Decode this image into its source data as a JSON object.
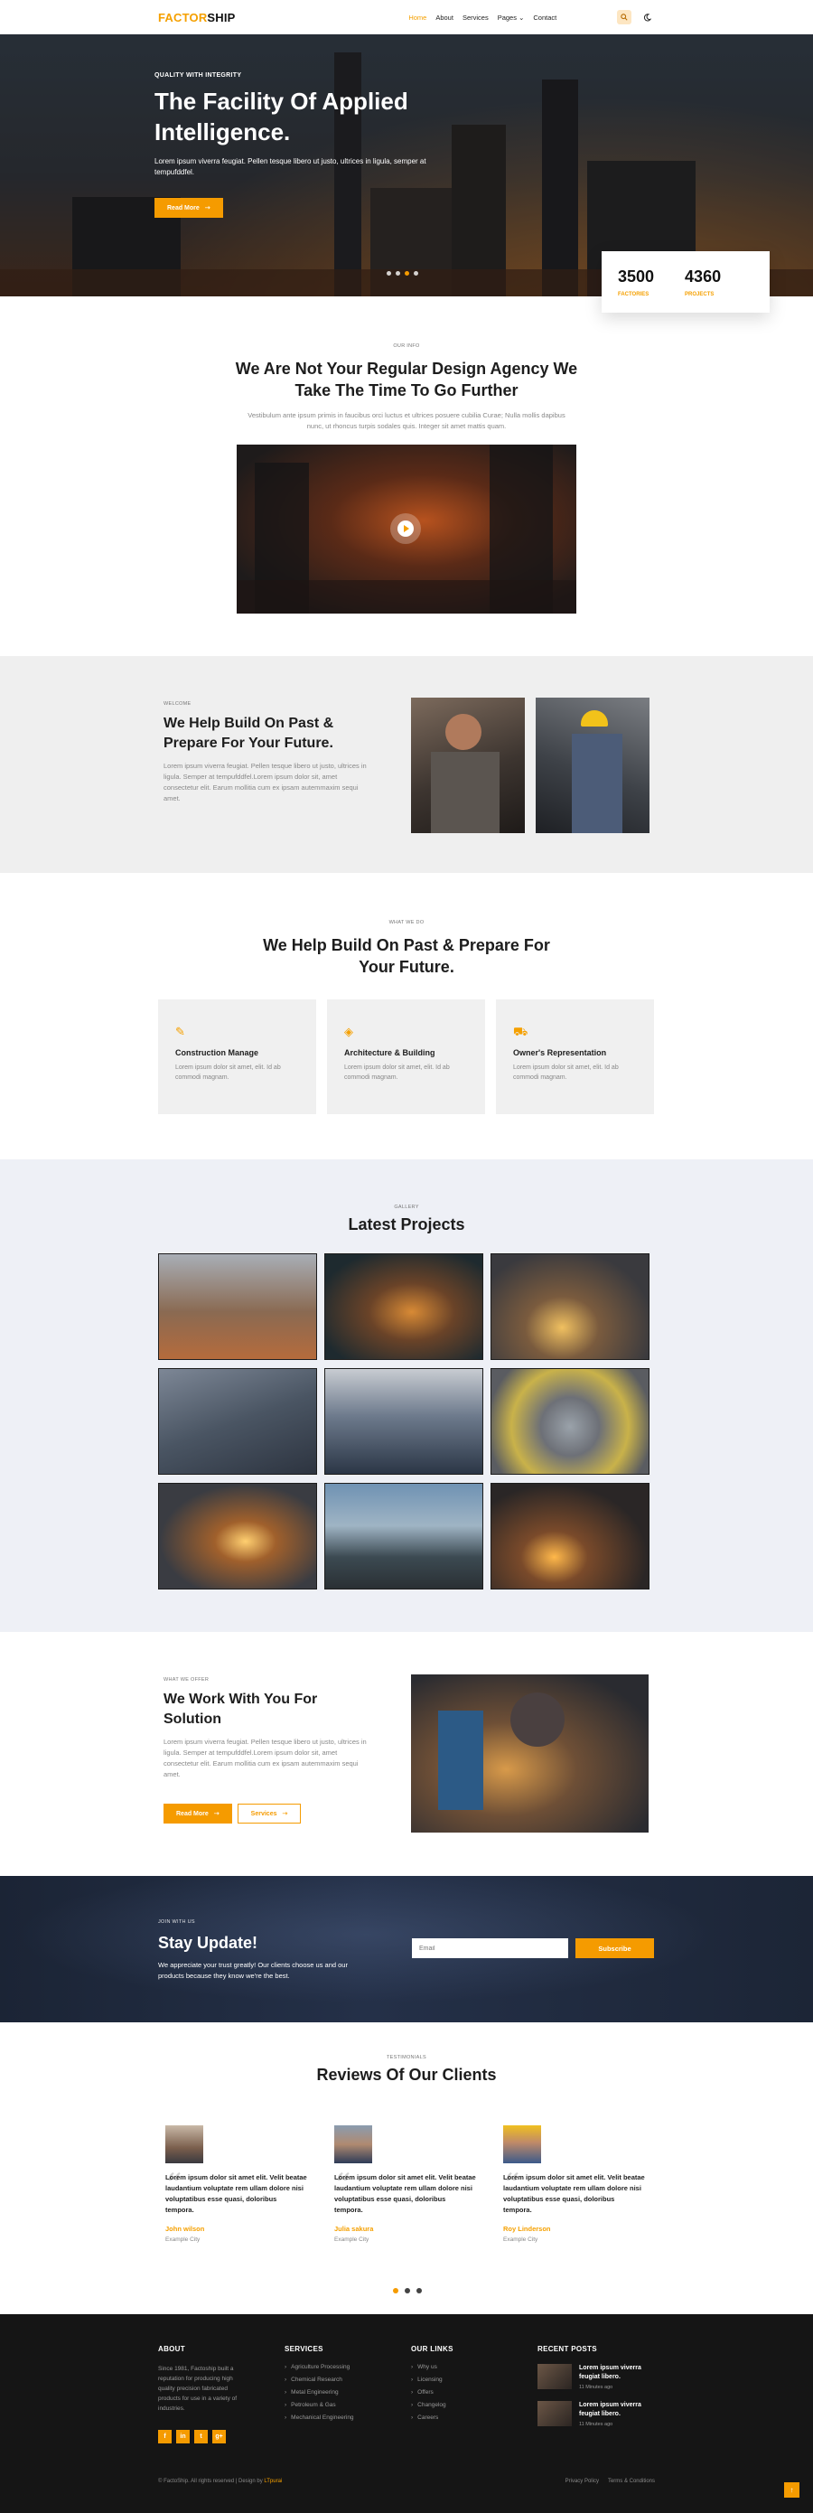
{
  "brand": {
    "part1": "FACTOR",
    "part2": "SHIP",
    "accent": "#f5a000"
  },
  "nav": {
    "items": [
      "Home",
      "About",
      "Services",
      "Pages",
      "Contact"
    ],
    "pages_caret": "⌄"
  },
  "hero": {
    "kicker": "QUALITY WITH INTEGRITY",
    "title_line1": "The Facility Of Applied",
    "title_line2": "Intelligence.",
    "description": "Lorem ipsum viverra feugiat. Pellen tesque libero ut justo, ultrices in ligula, semper at tempufddfel.",
    "button": "Read More"
  },
  "stats": [
    {
      "number": "3500",
      "label": "FACTORIES"
    },
    {
      "number": "4360",
      "label": "PROJECTS"
    }
  ],
  "about": {
    "kicker": "OUR INFO",
    "title_line1": "We Are Not Your Regular Design Agency We",
    "title_line2": "Take The Time To Go Further",
    "description": "Vestibulum ante ipsum primis in faucibus orci luctus et ultrices posuere cubilia Curae; Nulla mollis dapibus nunc, ut rhoncus turpis sodales quis. Integer sit amet mattis quam."
  },
  "welcome": {
    "kicker": "WELCOME",
    "title_line1": "We Help Build On Past &",
    "title_line2": "Prepare For Your Future.",
    "description": "Lorem ipsum viverra feugiat. Pellen tesque libero ut justo, ultrices in ligula. Semper at tempufddfel.Lorem ipsum dolor sit, amet consectetur elit. Earum mollitia cum ex ipsam autemmaxim sequi amet."
  },
  "services": {
    "kicker": "WHAT WE DO",
    "title_line1": "We Help Build On Past & Prepare For",
    "title_line2": "Your Future.",
    "cards": [
      {
        "title": "Construction Manage",
        "desc": "Lorem ipsum dolor sit amet, elit. Id ab commodi magnam."
      },
      {
        "title": "Architecture & Building",
        "desc": "Lorem ipsum dolor sit amet, elit. Id ab commodi magnam."
      },
      {
        "title": "Owner's Representation",
        "desc": "Lorem ipsum dolor sit amet, elit. Id ab commodi magnam."
      }
    ]
  },
  "gallery": {
    "kicker": "GALLERY",
    "title": "Latest Projects"
  },
  "offer": {
    "kicker": "WHAT WE OFFER",
    "title_line1": "We Work With You For",
    "title_line2": "Solution",
    "description": "Lorem ipsum viverra feugiat. Pellen tesque libero ut justo, ultrices in ligula. Semper at tempufddfel.Lorem ipsum dolor sit, amet consectetur elit. Earum mollitia cum ex ipsam autemmaxim sequi amet.",
    "button_primary": "Read More",
    "button_secondary": "Services"
  },
  "newsletter": {
    "kicker": "JOIN WITH US",
    "title": "Stay Update!",
    "description": "We appreciate your trust greatly! Our clients choose us and our products because they know we're the best.",
    "placeholder": "Email",
    "button": "Subscribe"
  },
  "reviews": {
    "kicker": "TESTIMONIALS",
    "title": "Reviews Of Our Clients",
    "items": [
      {
        "quote": "Lorem ipsum dolor sit amet elit. Velit beatae laudantium voluptate rem ullam dolore nisi voluptatibus esse quasi, doloribus tempora.",
        "name": "John wilson",
        "city": "Example City"
      },
      {
        "quote": "Lorem ipsum dolor sit amet elit. Velit beatae laudantium voluptate rem ullam dolore nisi voluptatibus esse quasi, doloribus tempora.",
        "name": "Julia sakura",
        "city": "Example City"
      },
      {
        "quote": "Lorem ipsum dolor sit amet elit. Velit beatae laudantium voluptate rem ullam dolore nisi voluptatibus esse quasi, doloribus tempora.",
        "name": "Roy Linderson",
        "city": "Example City"
      }
    ]
  },
  "footer": {
    "about_title": "ABOUT",
    "about_text": "Since 1981, Factoship built a reputation for producing high quality precision fabricated products for use in a variety of industries.",
    "services_title": "SERVICES",
    "services": [
      "Agriculture Processing",
      "Chemical Research",
      "Metal Engineering",
      "Petroleum & Gas",
      "Mechanical Engineering"
    ],
    "links_title": "OUR LINKS",
    "links": [
      "Why us",
      "Licensing",
      "Offers",
      "Changelog",
      "Careers"
    ],
    "posts_title": "RECENT POSTS",
    "posts": [
      {
        "title": "Lorem ipsum viverra feugiat libero.",
        "date": "11 Minutes ago"
      },
      {
        "title": "Lorem ipsum viverra feugiat libero.",
        "date": "11 Minutes ago"
      }
    ],
    "socials": [
      "f",
      "in",
      "t",
      "g+"
    ],
    "copyright_prefix": "© FactoShip. All rights reserved | Design by",
    "copyright_author": "LTpurai",
    "bottom_links": [
      "Privacy Policy",
      "Terms & Conditions"
    ],
    "to_top": "↑"
  }
}
